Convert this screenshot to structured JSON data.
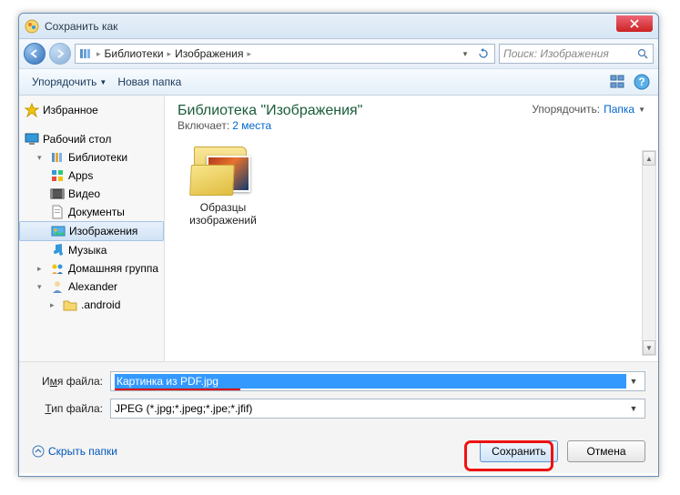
{
  "title": "Сохранить как",
  "breadcrumb": {
    "lvl1": "Библиотеки",
    "lvl2": "Изображения"
  },
  "search": {
    "placeholder": "Поиск: Изображения"
  },
  "toolbar": {
    "organize": "Упорядочить",
    "newfolder": "Новая папка"
  },
  "sidebar": {
    "favorites": "Избранное",
    "desktop": "Рабочий стол",
    "libraries": "Библиотеки",
    "apps": "Apps",
    "videos": "Видео",
    "documents": "Документы",
    "pictures": "Изображения",
    "music": "Музыка",
    "homegroup": "Домашняя группа",
    "user": "Alexander",
    "android": ".android"
  },
  "content": {
    "heading": "Библиотека \"Изображения\"",
    "includes_label": "Включает:",
    "includes_link": "2 места",
    "sort_label": "Упорядочить:",
    "sort_value": "Папка",
    "folder1": "Образцы изображений"
  },
  "form": {
    "filename_label_pre": "И",
    "filename_label_u": "м",
    "filename_label_post": "я файла:",
    "filename_value": "Картинка из PDF.jpg",
    "filetype_label_pre": "",
    "filetype_label_u": "Т",
    "filetype_label_post": "ип файла:",
    "filetype_value": "JPEG (*.jpg;*.jpeg;*.jpe;*.jfif)"
  },
  "footer": {
    "hide": "Скрыть папки",
    "save": "Сохранить",
    "cancel": "Отмена"
  }
}
